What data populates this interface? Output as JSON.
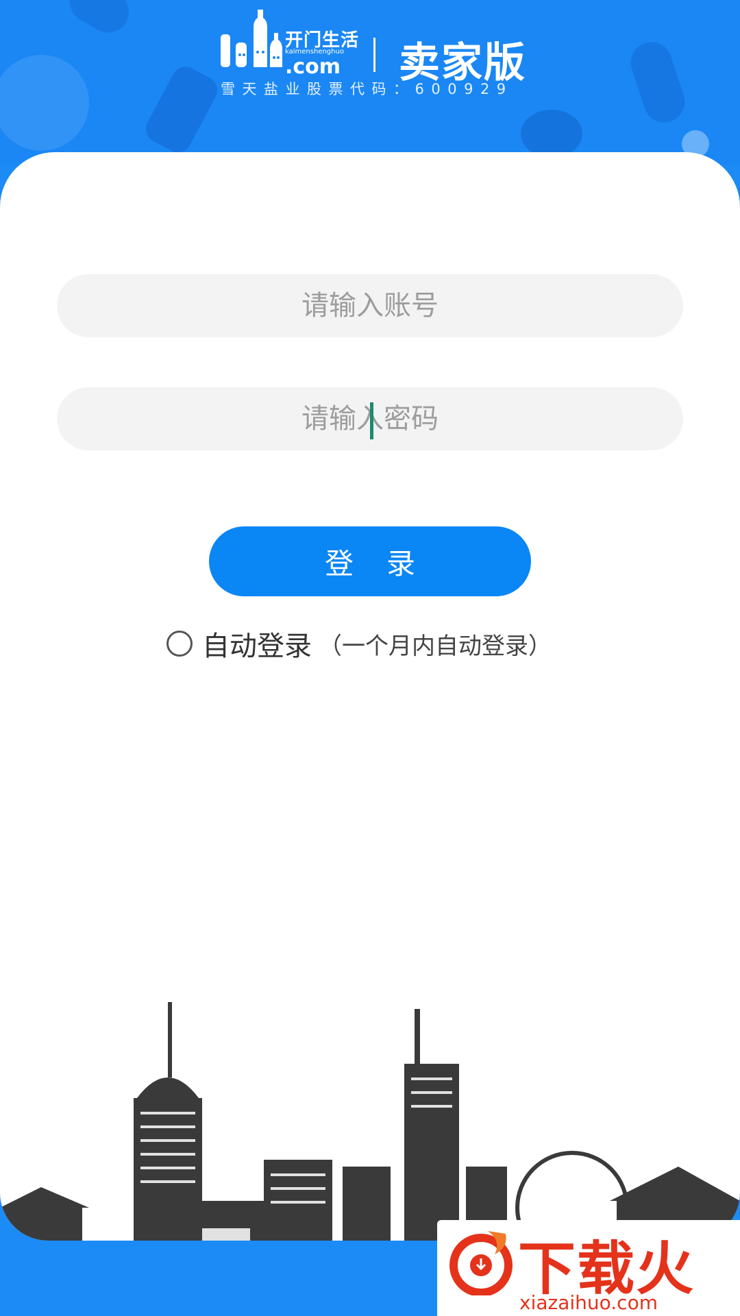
{
  "header": {
    "brand_cn": "开门生活",
    "brand_pinyin": "kaimenshenghuo",
    "brand_com": ".com",
    "edition": "卖家版",
    "stock_text": "雪天盐业股票代码：600929"
  },
  "form": {
    "account_placeholder": "请输入账号",
    "password_placeholder": "请输入密码",
    "login_label": "登录",
    "auto_login_label": "自动登录",
    "auto_login_note": "（一个月内自动登录）"
  },
  "watermark": {
    "text": "下载火",
    "url": "xiazaihuo.com"
  },
  "colors": {
    "brand_blue": "#1a87f4",
    "button_blue": "#0a86f5",
    "watermark_red": "#e4321b"
  }
}
